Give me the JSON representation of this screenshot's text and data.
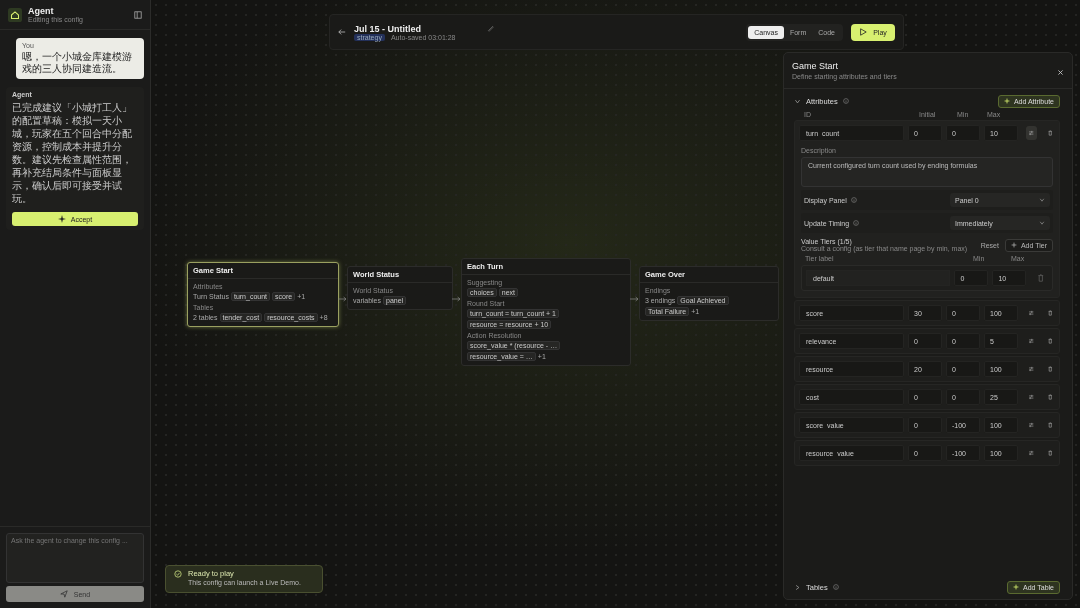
{
  "agent": {
    "title": "Agent",
    "subtitle": "Editing this config",
    "messages": [
      {
        "kind": "user",
        "author": "You",
        "text": "嗯，一个小城金库建模游戏的三人协同建造流。"
      },
      {
        "kind": "agent",
        "author": "Agent",
        "text": "已完成建议「小城打工人」的配置草稿：模拟一天小城，玩家在五个回合中分配资源，控制成本并提升分数。建议先检查属性范围，再补充结局条件与面板显示，确认后即可接受并试玩。",
        "action": "Accept"
      }
    ],
    "input": {
      "placeholder": "Ask the agent to change this config ..."
    },
    "send": "Send"
  },
  "topbar": {
    "title": "Jul 15 - Untitled",
    "tag": "strategy",
    "autosave": "Auto-saved 03:01:28",
    "views": [
      {
        "label": "Canvas",
        "selected": true
      },
      {
        "label": "Form",
        "selected": false
      },
      {
        "label": "Code",
        "selected": false
      }
    ],
    "play": "Play"
  },
  "nodes": [
    {
      "title": "Game Start",
      "selected": true,
      "rows": [
        {
          "label": "Attributes",
          "items": [
            {
              "kind": "text",
              "text": "Turn Status"
            },
            {
              "kind": "chip",
              "text": "turn_count"
            },
            {
              "kind": "chip",
              "text": "score"
            },
            {
              "kind": "count",
              "text": "+1"
            }
          ]
        },
        {
          "label": "Tables",
          "items": [
            {
              "kind": "text",
              "text": "2 tables"
            },
            {
              "kind": "chip",
              "text": "tender_cost"
            },
            {
              "kind": "chip",
              "text": "resource_costs"
            },
            {
              "kind": "count",
              "text": "+8"
            }
          ]
        }
      ]
    },
    {
      "title": "World Status",
      "selected": false,
      "rows": [
        {
          "label": "World Status",
          "items": [
            {
              "kind": "text",
              "text": "variables"
            },
            {
              "kind": "chip",
              "text": "panel"
            }
          ]
        }
      ]
    },
    {
      "title": "Each Turn",
      "selected": false,
      "rows": [
        {
          "label": "Suggesting",
          "items": [
            {
              "kind": "chip",
              "text": "choices"
            },
            {
              "kind": "chip",
              "text": "next"
            }
          ]
        },
        {
          "label": "Round Start",
          "items": [
            {
              "kind": "chip",
              "text": "turn_count = turn_count + 1"
            },
            {
              "kind": "chip",
              "text": "resource = resource + 10"
            }
          ]
        },
        {
          "label": "Action Resolution",
          "items": [
            {
              "kind": "chip",
              "text": "score_value * (resource - …"
            },
            {
              "kind": "chip",
              "text": "resource_value = …"
            },
            {
              "kind": "count",
              "text": "+1"
            }
          ]
        }
      ]
    },
    {
      "title": "Game Over",
      "selected": false,
      "rows": [
        {
          "label": "Endings",
          "items": [
            {
              "kind": "text",
              "text": "3 endings"
            },
            {
              "kind": "chip",
              "text": "Goal Achieved"
            },
            {
              "kind": "chip",
              "text": "Total Failure"
            },
            {
              "kind": "count",
              "text": "+1"
            }
          ]
        }
      ]
    }
  ],
  "panel": {
    "title": "Game Start",
    "subtitle": "Define starting attributes and tiers",
    "attributes": {
      "title": "Attributes",
      "expanded": true,
      "add": "Add Attribute",
      "columns": [
        "ID",
        "Initial",
        "Min",
        "Max"
      ],
      "rows": [
        {
          "id": "turn_count",
          "initial": "0",
          "min": "0",
          "max": "10",
          "expanded": true
        },
        {
          "id": "score",
          "initial": "30",
          "min": "0",
          "max": "100",
          "expanded": false
        },
        {
          "id": "relevance",
          "initial": "0",
          "min": "0",
          "max": "5",
          "expanded": false
        },
        {
          "id": "resource",
          "initial": "20",
          "min": "0",
          "max": "100",
          "expanded": false
        },
        {
          "id": "cost",
          "initial": "0",
          "min": "0",
          "max": "25",
          "expanded": false
        },
        {
          "id": "score_value",
          "initial": "0",
          "min": "-100",
          "max": "100",
          "expanded": false
        },
        {
          "id": "resource_value",
          "initial": "0",
          "min": "-100",
          "max": "100",
          "expanded": false
        }
      ],
      "detail": {
        "description_label": "Description",
        "description": "Current configured turn count used by ending formulas",
        "display_label": "Display Panel",
        "display_value": "Panel 0",
        "timing_label": "Update Timing",
        "timing_value": "Immediately",
        "tiers_title": "Value Tiers (1/5)",
        "tiers_hint": "Consult a config (as tier that name page by min, max)",
        "reset": "Reset",
        "add_tier": "Add Tier",
        "tier_columns": [
          "Tier label",
          "Min",
          "Max"
        ],
        "tiers": [
          {
            "label": "default",
            "min": "0",
            "max": "10"
          }
        ]
      }
    },
    "tables": {
      "title": "Tables",
      "expanded": false,
      "add": "Add Table"
    }
  },
  "toast": {
    "title": "Ready to play",
    "text": "This config can launch a Live Demo."
  }
}
